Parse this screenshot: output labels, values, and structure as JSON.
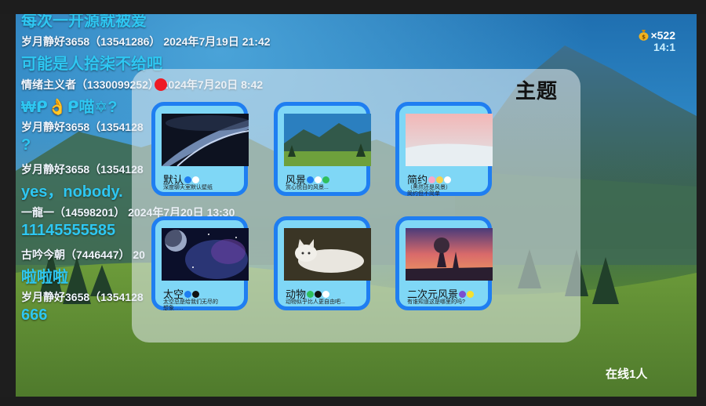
{
  "chat": {
    "partial_top": "每次一开源就被爱",
    "messages": [
      {
        "header": "岁月静好3658（13541286） 2024年7月19日 21:42",
        "body": "可能是人拾柒不给吧"
      },
      {
        "header": "情绪主义者（1330099252） 2024年7月20日 8:42",
        "body": "₩ᑭ👌ᑭ喵✡?"
      },
      {
        "header": "岁月静好3658（1354128",
        "body": "?"
      },
      {
        "header": "岁月静好3658（1354128",
        "body": "yes，nobody."
      },
      {
        "header": "一龍一（14598201） 2024年7月20日 13:30",
        "body": "11145555585"
      },
      {
        "header": "古吟今朝（7446447） 20",
        "body": "啦啦啦"
      },
      {
        "header": "岁月静好3658（1354128",
        "body": "666"
      }
    ]
  },
  "coins": {
    "value": "×522",
    "ratio": "14:1",
    "icon": "money-bag-icon"
  },
  "online": "在线1人",
  "theme_panel": {
    "title": "主题",
    "close_color": "#ee1b24",
    "themes": [
      {
        "name": "默认",
        "desc": "深度聊天室默认壁纸",
        "colors": [
          "#1f7ef1",
          "#ffffff"
        ]
      },
      {
        "name": "风景",
        "desc": "赏心悦目的风景...",
        "colors": [
          "#1f7ef1",
          "#ffffff",
          "#2fbf5c"
        ]
      },
      {
        "name": "简约",
        "desc": "（黑然还是风景）\n简约但不简单",
        "colors": [
          "#f7a8c8",
          "#f6d24a",
          "#ffffff"
        ]
      },
      {
        "name": "太空",
        "desc": "太空总是给我们无尽的\n想象......",
        "colors": [
          "#1f7ef1",
          "#111111"
        ]
      },
      {
        "name": "动物",
        "desc": "动物似乎比人更自由吧...",
        "colors": [
          "#2fbf5c",
          "#111111",
          "#ffffff"
        ]
      },
      {
        "name": "二次元风景",
        "desc": "有谁知道这是哪里的吗?",
        "colors": [
          "#7b4fd0",
          "#f6e130"
        ]
      }
    ]
  }
}
